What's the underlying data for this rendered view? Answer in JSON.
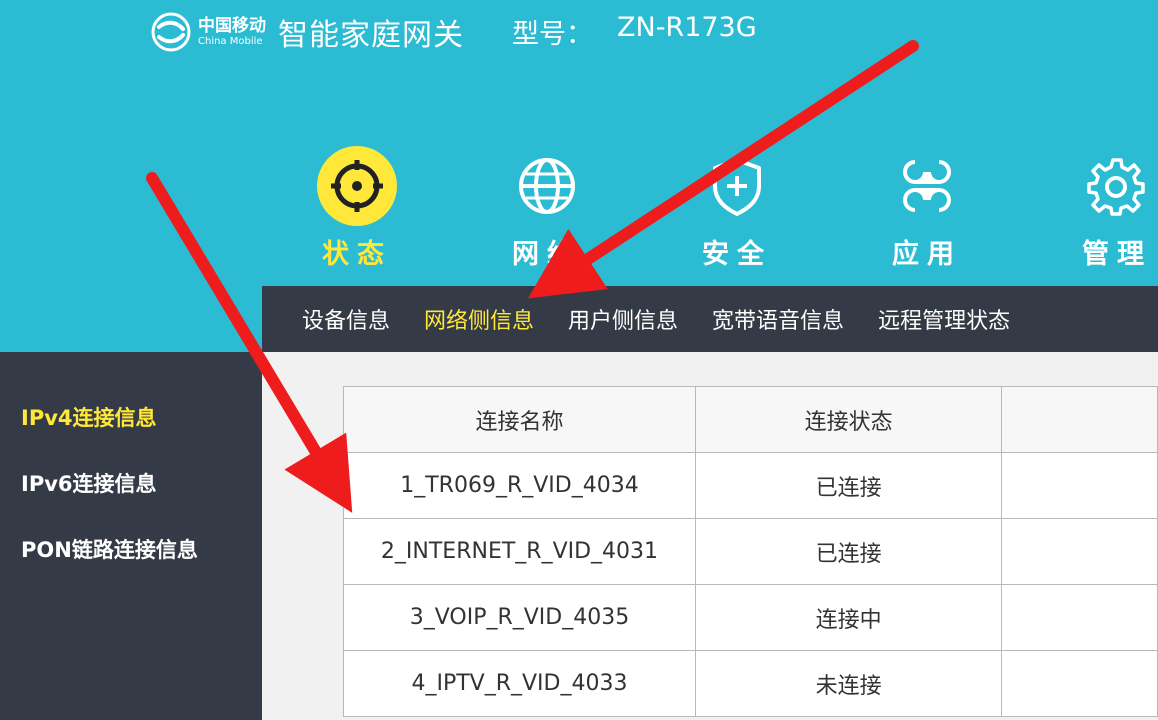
{
  "header": {
    "brand_cn": "中国移动",
    "brand_en": "China Mobile",
    "product_name": "智能家庭网关",
    "model_label": "型号：",
    "model_value": "ZN-R173G"
  },
  "main_nav": [
    {
      "label": "状态",
      "icon": "target-icon",
      "active": true
    },
    {
      "label": "网络",
      "icon": "globe-icon",
      "active": false
    },
    {
      "label": "安全",
      "icon": "shield-plus-icon",
      "active": false
    },
    {
      "label": "应用",
      "icon": "apps-icon",
      "active": false
    },
    {
      "label": "管理",
      "icon": "gear-icon",
      "active": false
    }
  ],
  "sub_nav": [
    {
      "label": "设备信息",
      "active": false
    },
    {
      "label": "网络侧信息",
      "active": true
    },
    {
      "label": "用户侧信息",
      "active": false
    },
    {
      "label": "宽带语音信息",
      "active": false
    },
    {
      "label": "远程管理状态",
      "active": false
    }
  ],
  "sidebar": [
    {
      "label": "IPv4连接信息",
      "active": true
    },
    {
      "label": "IPv6连接信息",
      "active": false
    },
    {
      "label": "PON链路连接信息",
      "active": false
    }
  ],
  "table": {
    "headers": [
      "连接名称",
      "连接状态",
      ""
    ],
    "rows": [
      [
        "1_TR069_R_VID_4034",
        "已连接",
        ""
      ],
      [
        "2_INTERNET_R_VID_4031",
        "已连接",
        ""
      ],
      [
        "3_VOIP_R_VID_4035",
        "连接中",
        ""
      ],
      [
        "4_IPTV_R_VID_4033",
        "未连接",
        ""
      ]
    ]
  },
  "colors": {
    "header_bg": "#2bbcd4",
    "dark_bg": "#353b46",
    "active": "#ffe83a",
    "arrow": "#ee1c1c"
  }
}
